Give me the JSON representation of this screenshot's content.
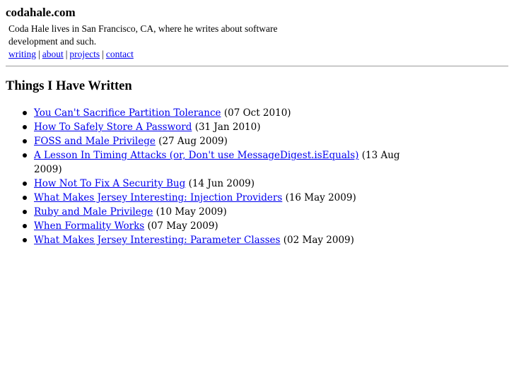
{
  "header": {
    "site_title": "codahale.com",
    "tagline": "Coda Hale lives in San Francisco, CA, where he writes about software development and such.",
    "nav": [
      {
        "label": "writing"
      },
      {
        "label": "about"
      },
      {
        "label": "projects"
      },
      {
        "label": "contact"
      }
    ],
    "nav_separator": "|"
  },
  "main": {
    "heading": "Things I Have Written",
    "posts": [
      {
        "title": "You Can't Sacrifice Partition Tolerance",
        "date": "(07 Oct 2010)"
      },
      {
        "title": "How To Safely Store A Password",
        "date": "(31 Jan 2010)"
      },
      {
        "title": "FOSS and Male Privilege",
        "date": "(27 Aug 2009)"
      },
      {
        "title": "A Lesson In Timing Attacks (or, Don't use MessageDigest.isEquals)",
        "date": "(13 Aug 2009)"
      },
      {
        "title": "How Not To Fix A Security Bug",
        "date": "(14 Jun 2009)"
      },
      {
        "title": "What Makes Jersey Interesting: Injection Providers",
        "date": "(16 May 2009)"
      },
      {
        "title": "Ruby and Male Privilege",
        "date": "(10 May 2009)"
      },
      {
        "title": "When Formality Works",
        "date": "(07 May 2009)"
      },
      {
        "title": "What Makes Jersey Interesting: Parameter Classes",
        "date": "(02 May 2009)"
      }
    ]
  },
  "colors": {
    "link": "#0000ee",
    "text": "#000000",
    "rule": "#9a9a9a",
    "background": "#ffffff"
  }
}
